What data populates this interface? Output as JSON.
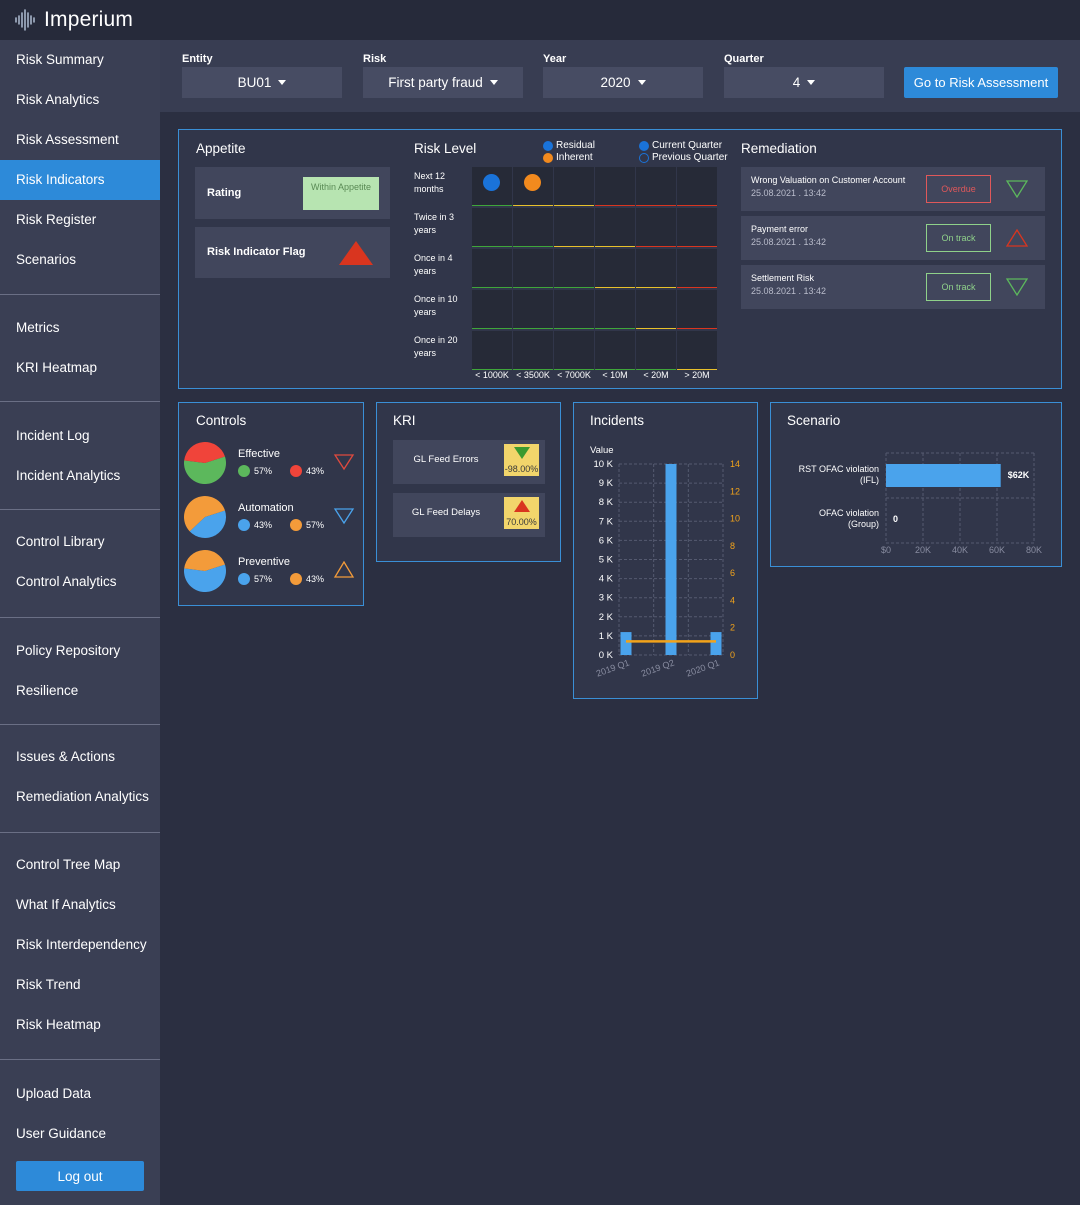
{
  "app": {
    "name": "Imperium"
  },
  "sidebar": {
    "groups": [
      [
        "Risk Summary",
        "Risk Analytics",
        "Risk Assessment",
        "Risk Indicators",
        "Risk Register",
        "Scenarios"
      ],
      [
        "Metrics",
        "KRI Heatmap"
      ],
      [
        "Incident Log",
        "Incident Analytics"
      ],
      [
        "Control Library",
        "Control Analytics"
      ],
      [
        "Policy Repository",
        "Resilience"
      ],
      [
        "Issues & Actions",
        "Remediation Analytics"
      ],
      [
        "Control Tree Map",
        "What If Analytics",
        "Risk Interdependency",
        "Risk Trend",
        "Risk Heatmap"
      ],
      [
        "Upload Data",
        "User Guidance"
      ]
    ],
    "active": "Risk Indicators",
    "logout_label": "Log out"
  },
  "filters": {
    "entity": {
      "label": "Entity",
      "value": "BU01"
    },
    "risk": {
      "label": "Risk",
      "value": "First party fraud"
    },
    "year": {
      "label": "Year",
      "value": "2020"
    },
    "quarter": {
      "label": "Quarter",
      "value": "4"
    },
    "go_label": "Go to Risk Assessment"
  },
  "appetite": {
    "title": "Appetite",
    "rating_label": "Rating",
    "rating_value": "Within Appetite",
    "flag_label": "Risk Indicator Flag",
    "flag_color": "#d9351f"
  },
  "risk_level": {
    "title": "Risk Level",
    "legend": {
      "residual": "Residual",
      "inherent": "Inherent",
      "current": "Current Quarter",
      "previous": "Previous Quarter"
    },
    "rows": [
      "Next 12 months",
      "Twice in 3 years",
      "Once in 4 years",
      "Once in 10 years",
      "Once in 20 years"
    ],
    "cols": [
      "< 1000K",
      "< 3500K",
      "< 7000K",
      "< 10M",
      "< 20M",
      "> 20M"
    ],
    "markers": {
      "residual": {
        "row": 0,
        "col": 0
      },
      "inherent": {
        "row": 0,
        "col": 1
      }
    },
    "colors": {
      "residual": "#1a73d9",
      "inherent": "#f28a1e",
      "green": "#3fa63a",
      "yellow": "#e8c12b",
      "red": "#d9351f"
    }
  },
  "remediation": {
    "title": "Remediation",
    "items": [
      {
        "title": "Wrong Valuation on Customer Account",
        "date": "25.08.2021 . 13:42",
        "status": "Overdue",
        "trend": "down"
      },
      {
        "title": "Payment error",
        "date": "25.08.2021 . 13:42",
        "status": "On track",
        "trend": "up"
      },
      {
        "title": "Settlement Risk",
        "date": "25.08.2021 . 13:42",
        "status": "On track",
        "trend": "down"
      }
    ]
  },
  "controls": {
    "title": "Controls",
    "items": [
      {
        "name": "Effective",
        "a": "57%",
        "b": "43%",
        "colorA": "#5cb85c",
        "colorB": "#f0443a",
        "trend": "down",
        "trendColor": "#e04a3e"
      },
      {
        "name": "Automation",
        "a": "43%",
        "b": "57%",
        "colorA": "#4aa3ec",
        "colorB": "#f39b3a",
        "trend": "down",
        "trendColor": "#4aa3ec"
      },
      {
        "name": "Preventive",
        "a": "57%",
        "b": "43%",
        "colorA": "#4aa3ec",
        "colorB": "#f39b3a",
        "trend": "up",
        "trendColor": "#f39b3a"
      }
    ]
  },
  "kri": {
    "title": "KRI",
    "items": [
      {
        "name": "GL Feed Errors",
        "value": "-98.00%",
        "trend": "down"
      },
      {
        "name": "GL Feed Delays",
        "value": "70.00%",
        "trend": "up"
      }
    ]
  },
  "incidents": {
    "title": "Incidents",
    "chart_data": {
      "type": "bar",
      "ylabel": "Value",
      "categories": [
        "2019 Q1",
        "2019 Q2",
        "2020 Q1"
      ],
      "series": [
        {
          "values": [
            1200,
            10000,
            1200
          ],
          "type": "bar",
          "axis": "left"
        },
        {
          "values": [
            1,
            1,
            1
          ],
          "type": "line",
          "axis": "right"
        }
      ],
      "left_ticks": [
        "0 K",
        "1 K",
        "2 K",
        "3 K",
        "4 K",
        "5 K",
        "6 K",
        "7 K",
        "8 K",
        "9 K",
        "10 K"
      ],
      "right_ticks": [
        "0",
        "2",
        "4",
        "6",
        "8",
        "10",
        "12",
        "14"
      ],
      "ylim": [
        0,
        10000
      ],
      "y2lim": [
        0,
        14
      ],
      "grid": true
    }
  },
  "scenario": {
    "title": "Scenario",
    "chart_data": {
      "type": "bar",
      "orientation": "horizontal",
      "categories": [
        "RST OFAC violation (IFL)",
        "OFAC violation (Group)"
      ],
      "values": [
        62000,
        0
      ],
      "value_labels": [
        "$62K",
        "0"
      ],
      "x_ticks": [
        "$0",
        "20K",
        "40K",
        "60K",
        "80K"
      ],
      "xlim": [
        0,
        80000
      ],
      "grid": true
    }
  },
  "colors": {
    "accent": "#2d8ad9",
    "panel_border": "#3a8fd6",
    "bar": "#4aa3ec",
    "line": "#f2a31b"
  }
}
